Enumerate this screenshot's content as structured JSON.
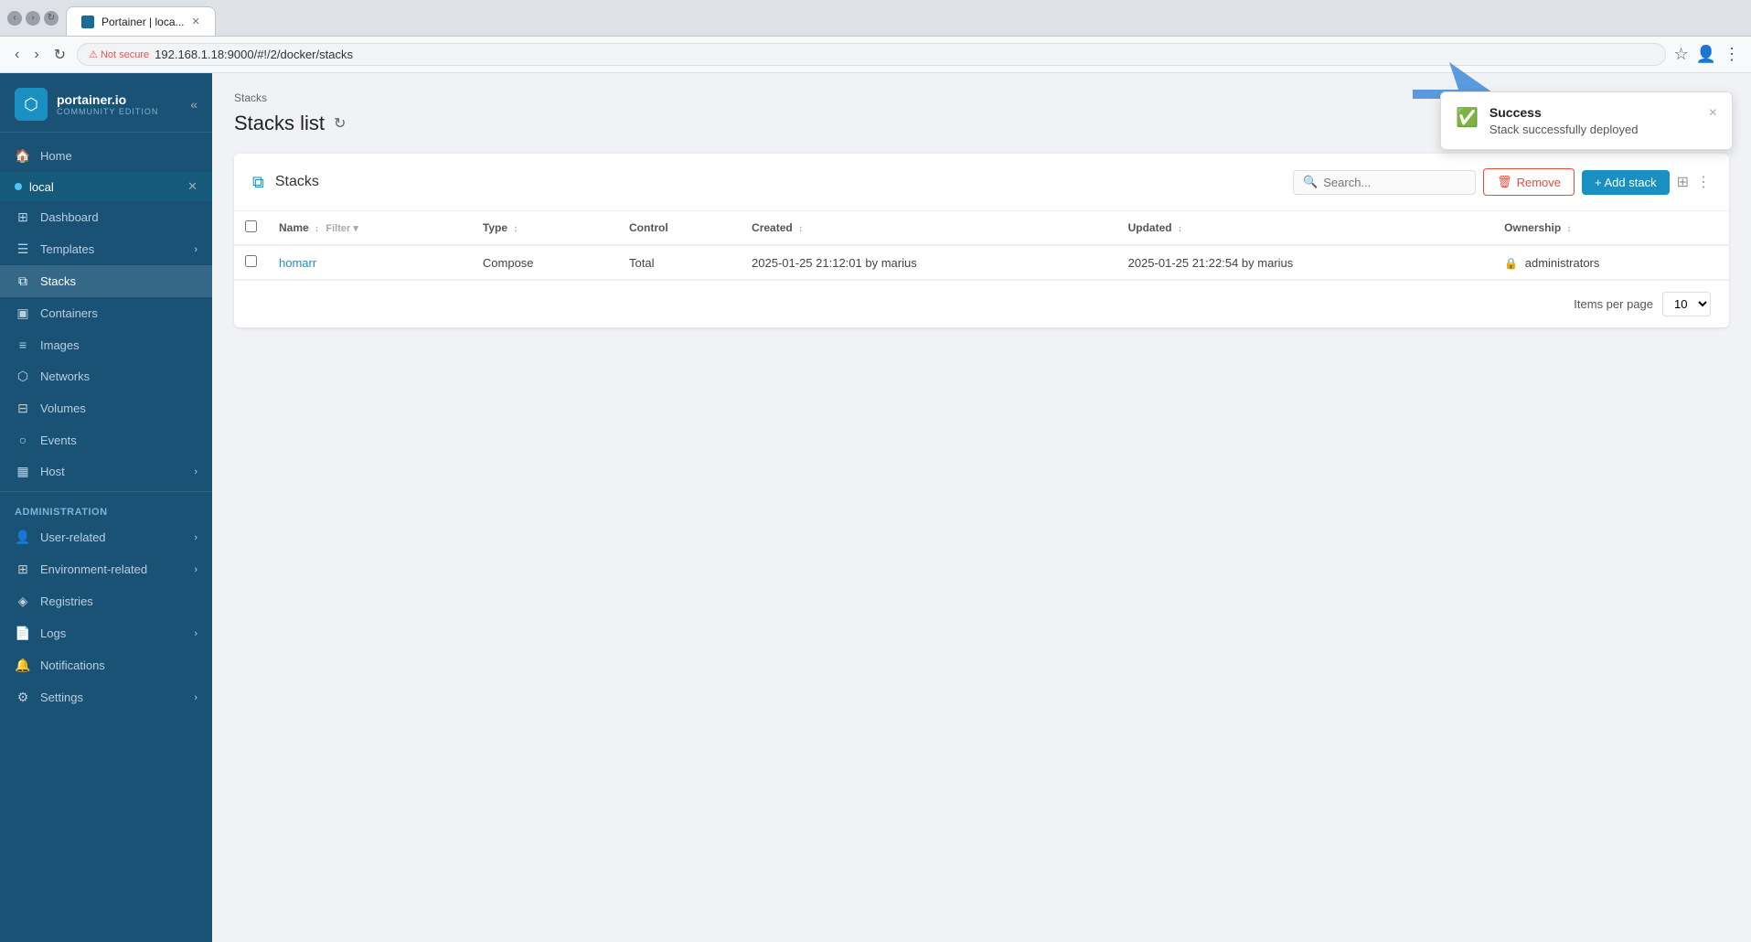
{
  "browser": {
    "tab_title": "Portainer | loca...",
    "address": "192.168.1.18:9000/#!/2/docker/stacks",
    "not_secure_label": "Not secure"
  },
  "sidebar": {
    "logo_title": "portainer.io",
    "logo_sub": "COMMUNITY EDITION",
    "collapse_icon": "«",
    "home_label": "Home",
    "env_name": "local",
    "nav_items": [
      {
        "label": "Dashboard",
        "icon": "⊞"
      },
      {
        "label": "Templates",
        "icon": "☰",
        "has_chevron": true
      },
      {
        "label": "Stacks",
        "icon": "⧉",
        "active": true
      },
      {
        "label": "Containers",
        "icon": "▣"
      },
      {
        "label": "Images",
        "icon": "≡"
      },
      {
        "label": "Networks",
        "icon": "⬡"
      },
      {
        "label": "Volumes",
        "icon": "⊟"
      },
      {
        "label": "Events",
        "icon": "○"
      },
      {
        "label": "Host",
        "icon": "▦",
        "has_chevron": true
      }
    ],
    "admin_label": "Administration",
    "admin_items": [
      {
        "label": "User-related",
        "icon": "👤",
        "has_chevron": true
      },
      {
        "label": "Environment-related",
        "icon": "⊞",
        "has_chevron": true
      },
      {
        "label": "Registries",
        "icon": "◈"
      },
      {
        "label": "Logs",
        "icon": "📄",
        "has_chevron": true
      },
      {
        "label": "Notifications",
        "icon": "🔔"
      },
      {
        "label": "Settings",
        "icon": "⚙",
        "has_chevron": true
      }
    ]
  },
  "page": {
    "breadcrumb": "Stacks",
    "title": "Stacks list"
  },
  "stacks_card": {
    "title": "Stacks",
    "search_placeholder": "Search...",
    "remove_label": "Remove",
    "add_label": "+ Add stack",
    "columns": [
      "Name",
      "Type",
      "Control",
      "Created",
      "Updated",
      "Ownership"
    ],
    "items_per_page_label": "Items per page",
    "items_per_page_value": "10",
    "rows": [
      {
        "name": "homarr",
        "type": "Compose",
        "control": "Total",
        "created": "2025-01-25 21:12:01 by marius",
        "updated": "2025-01-25 21:22:54 by marius",
        "ownership": "administrators"
      }
    ]
  },
  "toast": {
    "title": "Success",
    "message": "Stack successfully deployed",
    "close_label": "×"
  }
}
